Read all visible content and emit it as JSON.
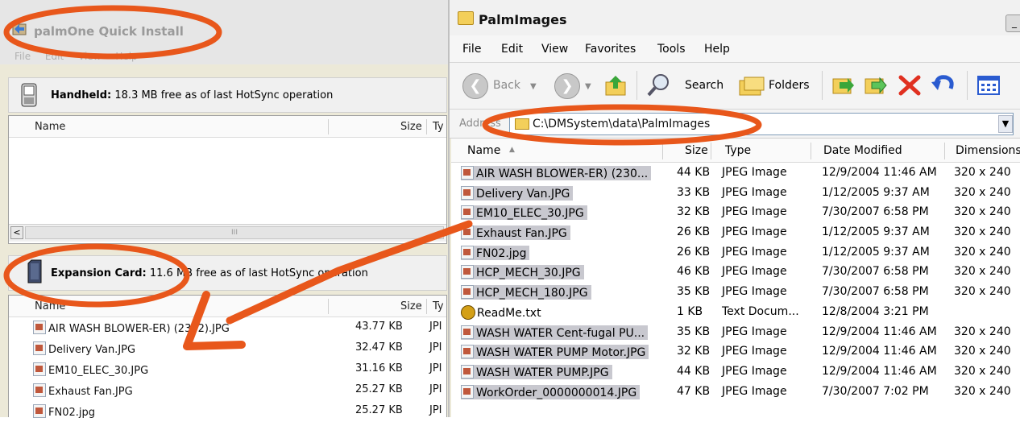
{
  "left_window": {
    "title": "palmOne Quick Install",
    "menu": [
      "File",
      "Edit",
      "View",
      "Help"
    ],
    "handheld": {
      "label": "Handheld:",
      "info": "18.3 MB free as of last HotSync operation",
      "columns": {
        "name": "Name",
        "size": "Size",
        "type": "Ty"
      }
    },
    "scrollbar": {
      "left_arrow": "<",
      "thumb": "III"
    },
    "expansion": {
      "label": "Expansion Card:",
      "info": "11.6 MB free as of last HotSync operation",
      "columns": {
        "name": "Name",
        "size": "Size",
        "type": "Ty"
      },
      "files": [
        {
          "name": "AIR WASH BLOWER-ER) (2302).JPG",
          "size": "43.77 KB",
          "type": "JPI"
        },
        {
          "name": "Delivery Van.JPG",
          "size": "32.47 KB",
          "type": "JPI"
        },
        {
          "name": "EM10_ELEC_30.JPG",
          "size": "31.16 KB",
          "type": "JPI"
        },
        {
          "name": "Exhaust Fan.JPG",
          "size": "25.27 KB",
          "type": "JPI"
        },
        {
          "name": "FN02.jpg",
          "size": "25.27 KB",
          "type": "JPI"
        }
      ]
    }
  },
  "right_window": {
    "title": "PalmImages",
    "menu": [
      "File",
      "Edit",
      "View",
      "Favorites",
      "Tools",
      "Help"
    ],
    "toolbar": {
      "back": "Back",
      "search": "Search",
      "folders": "Folders"
    },
    "address": {
      "label": "Address",
      "path": "C:\\DMSystem\\data\\PalmImages"
    },
    "columns": {
      "name": "Name",
      "size": "Size",
      "type": "Type",
      "date": "Date Modified",
      "dims": "Dimensions"
    },
    "files": [
      {
        "name": "AIR WASH BLOWER-ER) (230...",
        "size": "44 KB",
        "type": "JPEG Image",
        "date": "12/9/2004 11:46 AM",
        "dims": "320 x 240",
        "icon": "jpg"
      },
      {
        "name": "Delivery Van.JPG",
        "size": "33 KB",
        "type": "JPEG Image",
        "date": "1/12/2005 9:37 AM",
        "dims": "320 x 240",
        "icon": "jpg"
      },
      {
        "name": "EM10_ELEC_30.JPG",
        "size": "32 KB",
        "type": "JPEG Image",
        "date": "7/30/2007 6:58 PM",
        "dims": "320 x 240",
        "icon": "jpg"
      },
      {
        "name": "Exhaust Fan.JPG",
        "size": "26 KB",
        "type": "JPEG Image",
        "date": "1/12/2005 9:37 AM",
        "dims": "320 x 240",
        "icon": "jpg"
      },
      {
        "name": "FN02.jpg",
        "size": "26 KB",
        "type": "JPEG Image",
        "date": "1/12/2005 9:37 AM",
        "dims": "320 x 240",
        "icon": "jpg"
      },
      {
        "name": "HCP_MECH_30.JPG",
        "size": "46 KB",
        "type": "JPEG Image",
        "date": "7/30/2007 6:58 PM",
        "dims": "320 x 240",
        "icon": "jpg"
      },
      {
        "name": "HCP_MECH_180.JPG",
        "size": "35 KB",
        "type": "JPEG Image",
        "date": "7/30/2007 6:58 PM",
        "dims": "320 x 240",
        "icon": "jpg"
      },
      {
        "name": "ReadMe.txt",
        "size": "1 KB",
        "type": "Text Docum...",
        "date": "12/8/2004 3:21 PM",
        "dims": "",
        "icon": "txt"
      },
      {
        "name": "WASH WATER Cent-fugal PU...",
        "size": "35 KB",
        "type": "JPEG Image",
        "date": "12/9/2004 11:46 AM",
        "dims": "320 x 240",
        "icon": "jpg"
      },
      {
        "name": "WASH WATER PUMP Motor.JPG",
        "size": "32 KB",
        "type": "JPEG Image",
        "date": "12/9/2004 11:46 AM",
        "dims": "320 x 240",
        "icon": "jpg"
      },
      {
        "name": "WASH WATER PUMP.JPG",
        "size": "44 KB",
        "type": "JPEG Image",
        "date": "12/9/2004 11:46 AM",
        "dims": "320 x 240",
        "icon": "jpg"
      },
      {
        "name": "WorkOrder_0000000014.JPG",
        "size": "47 KB",
        "type": "JPEG Image",
        "date": "7/30/2007 7:02 PM",
        "dims": "320 x 240",
        "icon": "jpg"
      }
    ]
  },
  "colors": {
    "annotation": "#e8571b",
    "selection": "#c8c8cf",
    "window_bg": "#ece9d8"
  }
}
